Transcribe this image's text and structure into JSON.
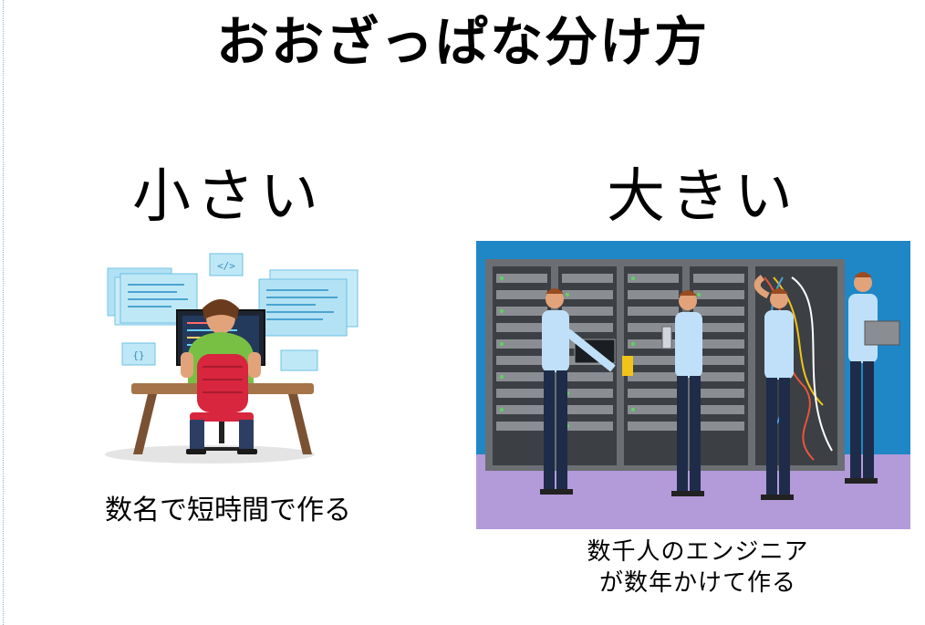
{
  "page": {
    "title": "おおざっぱな分け方"
  },
  "small": {
    "heading": "小さい",
    "caption": "数名で短時間で作る",
    "screen_tags": [
      "</>",
      "{}"
    ]
  },
  "large": {
    "heading": "大きい",
    "caption_line1": "数千人のエンジニア",
    "caption_line2": "が数年かけて作る"
  },
  "colors": {
    "sky_blue": "#1f87c6",
    "floor_purple": "#b39ad8",
    "rack_gray": "#6b6e72",
    "shirt_light_blue": "#bfe0f8",
    "pants_navy": "#1e2c4a",
    "chair_red": "#d7263d",
    "shirt_green": "#78c043",
    "desk_brown": "#a57448"
  }
}
